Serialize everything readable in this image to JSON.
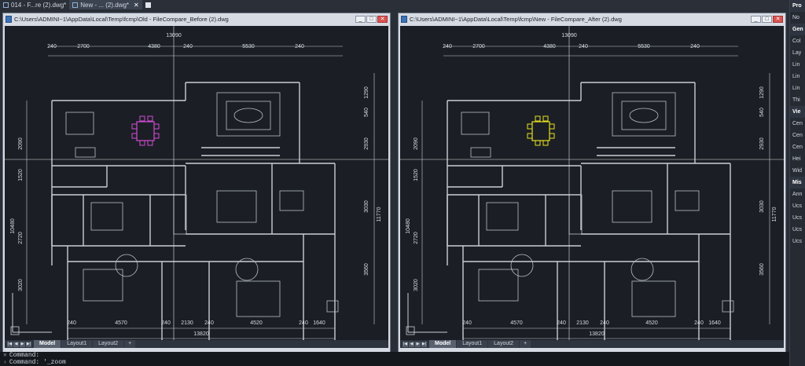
{
  "tabs": [
    {
      "label": "014 - F...re (2).dwg*",
      "active": false
    },
    {
      "label": "New - ...  (2).dwg*",
      "active": true
    }
  ],
  "left_window": {
    "title": "C:\\Users\\ADMINI~1\\AppData\\Local\\Temp\\fcmp\\Old - FileCompare_Before (2).dwg",
    "highlight_color": "#d24bd2",
    "dims_top": [
      "13090",
      "240",
      "2700",
      "4380",
      "240",
      "5530",
      "240"
    ],
    "dims_bottom": [
      "240",
      "4570",
      "240",
      "2130",
      "240",
      "4520",
      "240",
      "1640",
      "13820"
    ],
    "dims_left": [
      "2090",
      "1520",
      "10480",
      "2720",
      "3020"
    ],
    "dims_right": [
      "1290",
      "540",
      "2930",
      "3030",
      "11770",
      "3560"
    ]
  },
  "right_window": {
    "title": "C:\\Users\\ADMINI~1\\AppData\\Local\\Temp\\fcmp\\New - FileCompare_After (2).dwg",
    "highlight_color": "#e6e020",
    "dims_top": [
      "13090",
      "240",
      "2700",
      "4380",
      "240",
      "5530",
      "240"
    ],
    "dims_bottom": [
      "240",
      "4570",
      "240",
      "2130",
      "240",
      "4520",
      "240",
      "1640",
      "13820"
    ],
    "dims_left": [
      "2090",
      "1520",
      "10480",
      "2720",
      "3020"
    ],
    "dims_right": [
      "1290",
      "540",
      "2930",
      "3030",
      "11770",
      "3560"
    ]
  },
  "layout_tabs": [
    "Model",
    "Layout1",
    "Layout2",
    "+"
  ],
  "properties": {
    "header": "Pro",
    "no_selection": "No",
    "general": "Gen",
    "general_items": [
      "Col",
      "Lay",
      "Lin",
      "Lin",
      "Lin",
      "Thi"
    ],
    "view": "Vie",
    "view_items": [
      "Cen",
      "Cen",
      "Cen",
      "Hei",
      "Wid"
    ],
    "misc": "Mis",
    "misc_items": [
      "Ann",
      "Ucs",
      "Ucs",
      "Ucs",
      "Ucs"
    ]
  },
  "command": {
    "line1": "Command:",
    "line2": "Command: '_zoom"
  }
}
